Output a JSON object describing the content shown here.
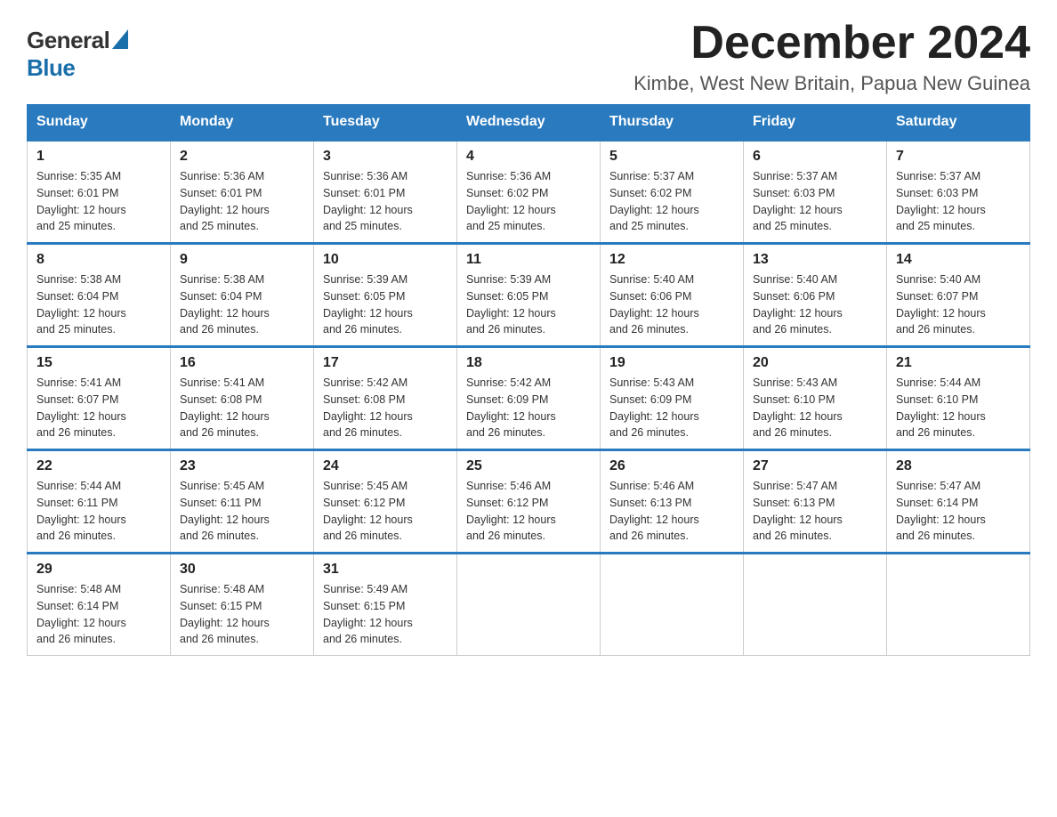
{
  "logo": {
    "general": "General",
    "blue": "Blue"
  },
  "title": "December 2024",
  "subtitle": "Kimbe, West New Britain, Papua New Guinea",
  "days_of_week": [
    "Sunday",
    "Monday",
    "Tuesday",
    "Wednesday",
    "Thursday",
    "Friday",
    "Saturday"
  ],
  "weeks": [
    [
      {
        "day": "1",
        "sunrise": "5:35 AM",
        "sunset": "6:01 PM",
        "daylight": "12 hours and 25 minutes."
      },
      {
        "day": "2",
        "sunrise": "5:36 AM",
        "sunset": "6:01 PM",
        "daylight": "12 hours and 25 minutes."
      },
      {
        "day": "3",
        "sunrise": "5:36 AM",
        "sunset": "6:01 PM",
        "daylight": "12 hours and 25 minutes."
      },
      {
        "day": "4",
        "sunrise": "5:36 AM",
        "sunset": "6:02 PM",
        "daylight": "12 hours and 25 minutes."
      },
      {
        "day": "5",
        "sunrise": "5:37 AM",
        "sunset": "6:02 PM",
        "daylight": "12 hours and 25 minutes."
      },
      {
        "day": "6",
        "sunrise": "5:37 AM",
        "sunset": "6:03 PM",
        "daylight": "12 hours and 25 minutes."
      },
      {
        "day": "7",
        "sunrise": "5:37 AM",
        "sunset": "6:03 PM",
        "daylight": "12 hours and 25 minutes."
      }
    ],
    [
      {
        "day": "8",
        "sunrise": "5:38 AM",
        "sunset": "6:04 PM",
        "daylight": "12 hours and 25 minutes."
      },
      {
        "day": "9",
        "sunrise": "5:38 AM",
        "sunset": "6:04 PM",
        "daylight": "12 hours and 26 minutes."
      },
      {
        "day": "10",
        "sunrise": "5:39 AM",
        "sunset": "6:05 PM",
        "daylight": "12 hours and 26 minutes."
      },
      {
        "day": "11",
        "sunrise": "5:39 AM",
        "sunset": "6:05 PM",
        "daylight": "12 hours and 26 minutes."
      },
      {
        "day": "12",
        "sunrise": "5:40 AM",
        "sunset": "6:06 PM",
        "daylight": "12 hours and 26 minutes."
      },
      {
        "day": "13",
        "sunrise": "5:40 AM",
        "sunset": "6:06 PM",
        "daylight": "12 hours and 26 minutes."
      },
      {
        "day": "14",
        "sunrise": "5:40 AM",
        "sunset": "6:07 PM",
        "daylight": "12 hours and 26 minutes."
      }
    ],
    [
      {
        "day": "15",
        "sunrise": "5:41 AM",
        "sunset": "6:07 PM",
        "daylight": "12 hours and 26 minutes."
      },
      {
        "day": "16",
        "sunrise": "5:41 AM",
        "sunset": "6:08 PM",
        "daylight": "12 hours and 26 minutes."
      },
      {
        "day": "17",
        "sunrise": "5:42 AM",
        "sunset": "6:08 PM",
        "daylight": "12 hours and 26 minutes."
      },
      {
        "day": "18",
        "sunrise": "5:42 AM",
        "sunset": "6:09 PM",
        "daylight": "12 hours and 26 minutes."
      },
      {
        "day": "19",
        "sunrise": "5:43 AM",
        "sunset": "6:09 PM",
        "daylight": "12 hours and 26 minutes."
      },
      {
        "day": "20",
        "sunrise": "5:43 AM",
        "sunset": "6:10 PM",
        "daylight": "12 hours and 26 minutes."
      },
      {
        "day": "21",
        "sunrise": "5:44 AM",
        "sunset": "6:10 PM",
        "daylight": "12 hours and 26 minutes."
      }
    ],
    [
      {
        "day": "22",
        "sunrise": "5:44 AM",
        "sunset": "6:11 PM",
        "daylight": "12 hours and 26 minutes."
      },
      {
        "day": "23",
        "sunrise": "5:45 AM",
        "sunset": "6:11 PM",
        "daylight": "12 hours and 26 minutes."
      },
      {
        "day": "24",
        "sunrise": "5:45 AM",
        "sunset": "6:12 PM",
        "daylight": "12 hours and 26 minutes."
      },
      {
        "day": "25",
        "sunrise": "5:46 AM",
        "sunset": "6:12 PM",
        "daylight": "12 hours and 26 minutes."
      },
      {
        "day": "26",
        "sunrise": "5:46 AM",
        "sunset": "6:13 PM",
        "daylight": "12 hours and 26 minutes."
      },
      {
        "day": "27",
        "sunrise": "5:47 AM",
        "sunset": "6:13 PM",
        "daylight": "12 hours and 26 minutes."
      },
      {
        "day": "28",
        "sunrise": "5:47 AM",
        "sunset": "6:14 PM",
        "daylight": "12 hours and 26 minutes."
      }
    ],
    [
      {
        "day": "29",
        "sunrise": "5:48 AM",
        "sunset": "6:14 PM",
        "daylight": "12 hours and 26 minutes."
      },
      {
        "day": "30",
        "sunrise": "5:48 AM",
        "sunset": "6:15 PM",
        "daylight": "12 hours and 26 minutes."
      },
      {
        "day": "31",
        "sunrise": "5:49 AM",
        "sunset": "6:15 PM",
        "daylight": "12 hours and 26 minutes."
      },
      null,
      null,
      null,
      null
    ]
  ],
  "labels": {
    "sunrise": "Sunrise:",
    "sunset": "Sunset:",
    "daylight": "Daylight:"
  }
}
